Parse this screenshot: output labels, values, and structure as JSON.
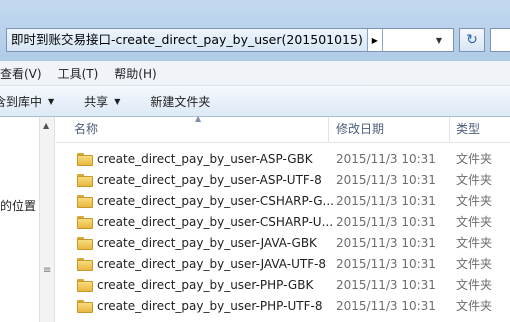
{
  "address_bar": {
    "path": "即时到账交易接口-create_direct_pay_by_user(201501015)"
  },
  "menu": {
    "items": [
      "查看(V)",
      "工具(T)",
      "帮助(H)"
    ]
  },
  "toolbar": {
    "include_in_library": "含到库中",
    "share": "共享",
    "new_folder": "新建文件夹"
  },
  "nav_pane": {
    "partial_item": "的位置"
  },
  "columns": {
    "name": "名称",
    "modified": "修改日期",
    "type": "类型"
  },
  "files": [
    {
      "name": "create_direct_pay_by_user-ASP-GBK",
      "modified": "2015/11/3 10:31",
      "type": "文件夹"
    },
    {
      "name": "create_direct_pay_by_user-ASP-UTF-8",
      "modified": "2015/11/3 10:31",
      "type": "文件夹"
    },
    {
      "name": "create_direct_pay_by_user-CSHARP-G...",
      "modified": "2015/11/3 10:31",
      "type": "文件夹"
    },
    {
      "name": "create_direct_pay_by_user-CSHARP-U...",
      "modified": "2015/11/3 10:31",
      "type": "文件夹"
    },
    {
      "name": "create_direct_pay_by_user-JAVA-GBK",
      "modified": "2015/11/3 10:31",
      "type": "文件夹"
    },
    {
      "name": "create_direct_pay_by_user-JAVA-UTF-8",
      "modified": "2015/11/3 10:31",
      "type": "文件夹"
    },
    {
      "name": "create_direct_pay_by_user-PHP-GBK",
      "modified": "2015/11/3 10:31",
      "type": "文件夹"
    },
    {
      "name": "create_direct_pay_by_user-PHP-UTF-8",
      "modified": "2015/11/3 10:31",
      "type": "文件夹"
    }
  ],
  "icons": {
    "folder": "folder-icon",
    "refresh": "refresh-icon",
    "breadcrumb_arrow": "chevron-right-icon",
    "dropdown": "chevron-down-icon"
  }
}
